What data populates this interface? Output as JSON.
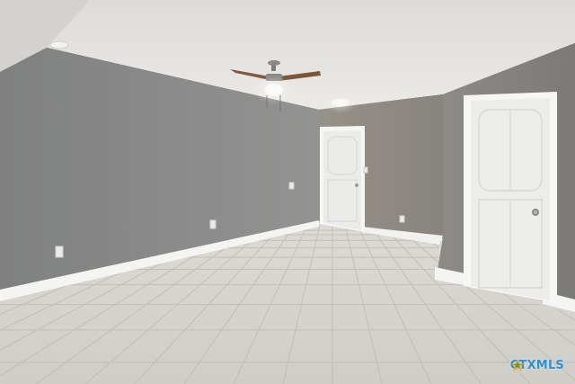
{
  "scene": {
    "subject": "empty-room-interior",
    "fixtures": [
      "ceiling-fan",
      "ceiling-light",
      "interior-door-center",
      "interior-door-right",
      "electrical-outlets",
      "light-switch"
    ],
    "flooring": "tile"
  },
  "colors": {
    "wall_left": "#898a8a",
    "wall_back": "#8e8a84",
    "wall_right": "#898885",
    "ceiling": "#e4e3e0",
    "floor": "#d8d6d0",
    "trim": "#f4f4f2",
    "door": "#efefed",
    "watermark": "#2f8fd3"
  },
  "watermark": {
    "text": "CTXMLS",
    "icon": "star-logo-icon"
  }
}
